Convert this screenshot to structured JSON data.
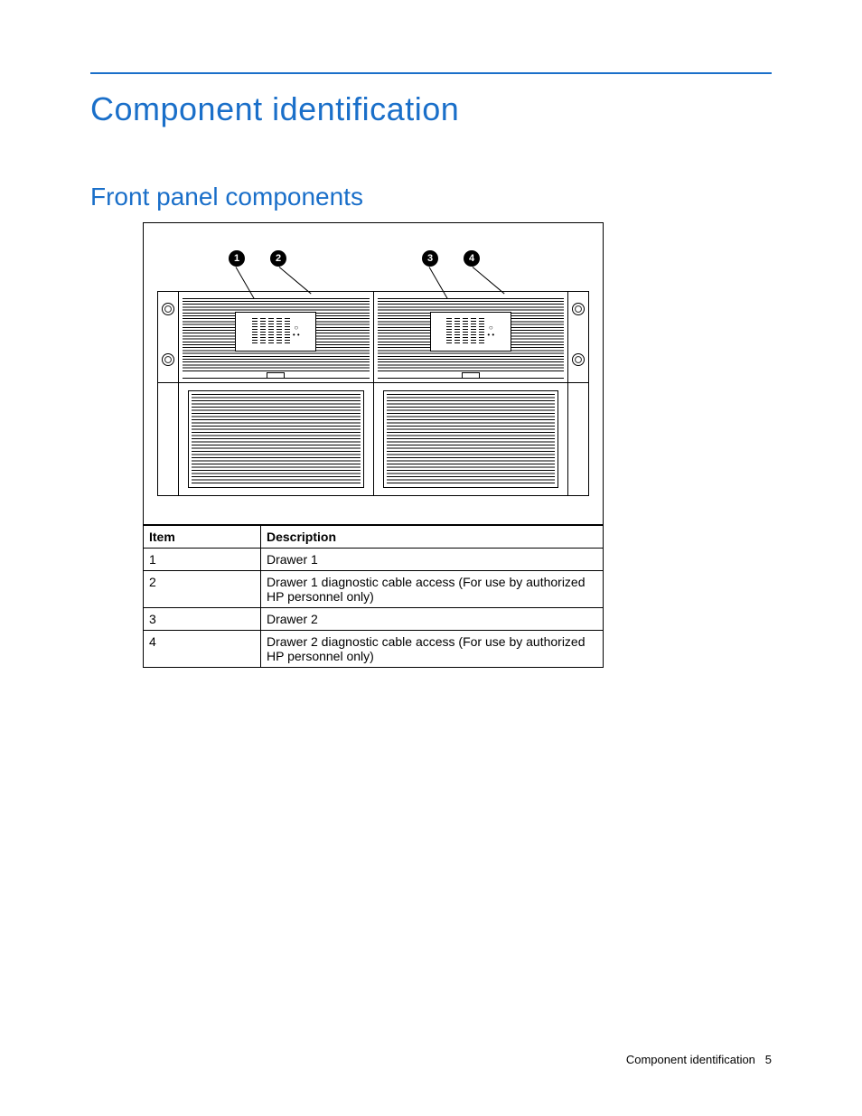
{
  "chapter_title": "Component identification",
  "section_title": "Front panel components",
  "callout_labels": {
    "c1": "1",
    "c2": "2",
    "c3": "3",
    "c4": "4"
  },
  "table": {
    "headers": {
      "item": "Item",
      "desc": "Description"
    },
    "rows": [
      {
        "item": "1",
        "desc": "Drawer 1"
      },
      {
        "item": "2",
        "desc": "Drawer 1 diagnostic cable access (For use by authorized HP personnel only)"
      },
      {
        "item": "3",
        "desc": "Drawer 2"
      },
      {
        "item": "4",
        "desc": "Drawer 2 diagnostic cable access (For use by authorized HP personnel only)"
      }
    ]
  },
  "footer": {
    "text": "Component identification",
    "page_number": "5"
  }
}
